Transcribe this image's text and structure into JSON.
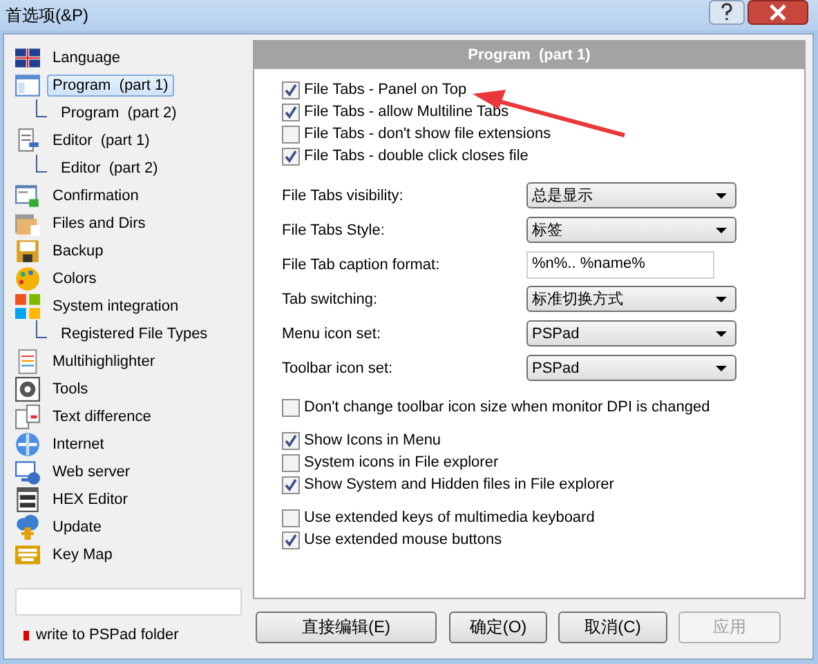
{
  "window": {
    "title": "首选项(&P)"
  },
  "sidebar": {
    "items": [
      {
        "label": "Language",
        "selected": false
      },
      {
        "label": "Program  (part 1)",
        "selected": true,
        "children": [
          {
            "label": "Program  (part 2)",
            "selected": false
          }
        ]
      },
      {
        "label": "Editor  (part 1)",
        "selected": false,
        "children": [
          {
            "label": "Editor  (part 2)",
            "selected": false
          }
        ]
      },
      {
        "label": "Confirmation",
        "selected": false
      },
      {
        "label": "Files and Dirs",
        "selected": false
      },
      {
        "label": "Backup",
        "selected": false
      },
      {
        "label": "Colors",
        "selected": false
      },
      {
        "label": "System integration",
        "selected": false,
        "children": [
          {
            "label": "Registered File Types",
            "selected": false
          }
        ]
      },
      {
        "label": "Multihighlighter",
        "selected": false
      },
      {
        "label": "Tools",
        "selected": false
      },
      {
        "label": "Text difference",
        "selected": false
      },
      {
        "label": "Internet",
        "selected": false
      },
      {
        "label": "Web server",
        "selected": false
      },
      {
        "label": "HEX Editor",
        "selected": false
      },
      {
        "label": "Update",
        "selected": false
      },
      {
        "label": "Key Map",
        "selected": false
      }
    ],
    "note": "write to PSPad folder"
  },
  "panel": {
    "title": "Program  (part 1)",
    "sections": [
      {
        "kind": "checkboxes",
        "items": [
          {
            "label": "File Tabs - Panel on Top",
            "checked": true
          },
          {
            "label": "File Tabs - allow Multiline Tabs",
            "checked": true
          },
          {
            "label": "File Tabs - don't show file extensions",
            "checked": false
          },
          {
            "label": "File Tabs - double click closes file",
            "checked": true
          }
        ]
      },
      {
        "kind": "form",
        "rows": [
          {
            "label": "File Tabs visibility:",
            "kind": "dropdown",
            "value": "总是显示"
          },
          {
            "label": "File Tabs Style:",
            "kind": "dropdown",
            "value": "标签"
          },
          {
            "label": "File Tab caption format:",
            "kind": "text",
            "value": "%n%.. %name%"
          },
          {
            "label": "Tab switching:",
            "kind": "dropdown",
            "value": "标准切换方式"
          },
          {
            "label": "Menu icon set:",
            "kind": "dropdown",
            "value": "PSPad"
          },
          {
            "label": "Toolbar icon set:",
            "kind": "dropdown",
            "value": "PSPad"
          }
        ]
      },
      {
        "kind": "checkboxes",
        "items": [
          {
            "label": "Don't change toolbar icon size when monitor DPI is changed",
            "checked": false
          }
        ]
      },
      {
        "kind": "checkboxes",
        "items": [
          {
            "label": "Show Icons in Menu",
            "checked": true
          },
          {
            "label": "System icons in File explorer",
            "checked": false
          },
          {
            "label": "Show System and Hidden files in File explorer",
            "checked": true
          }
        ]
      },
      {
        "kind": "checkboxes",
        "items": [
          {
            "label": "Use extended keys of multimedia keyboard",
            "checked": false
          },
          {
            "label": "Use extended mouse buttons",
            "checked": true
          }
        ]
      }
    ]
  },
  "buttons": [
    {
      "label": "直接编辑(E)",
      "disabled": false
    },
    {
      "label": "确定(O)",
      "disabled": false
    },
    {
      "label": "取消(C)",
      "disabled": false
    },
    {
      "label": "应用",
      "disabled": true
    }
  ]
}
